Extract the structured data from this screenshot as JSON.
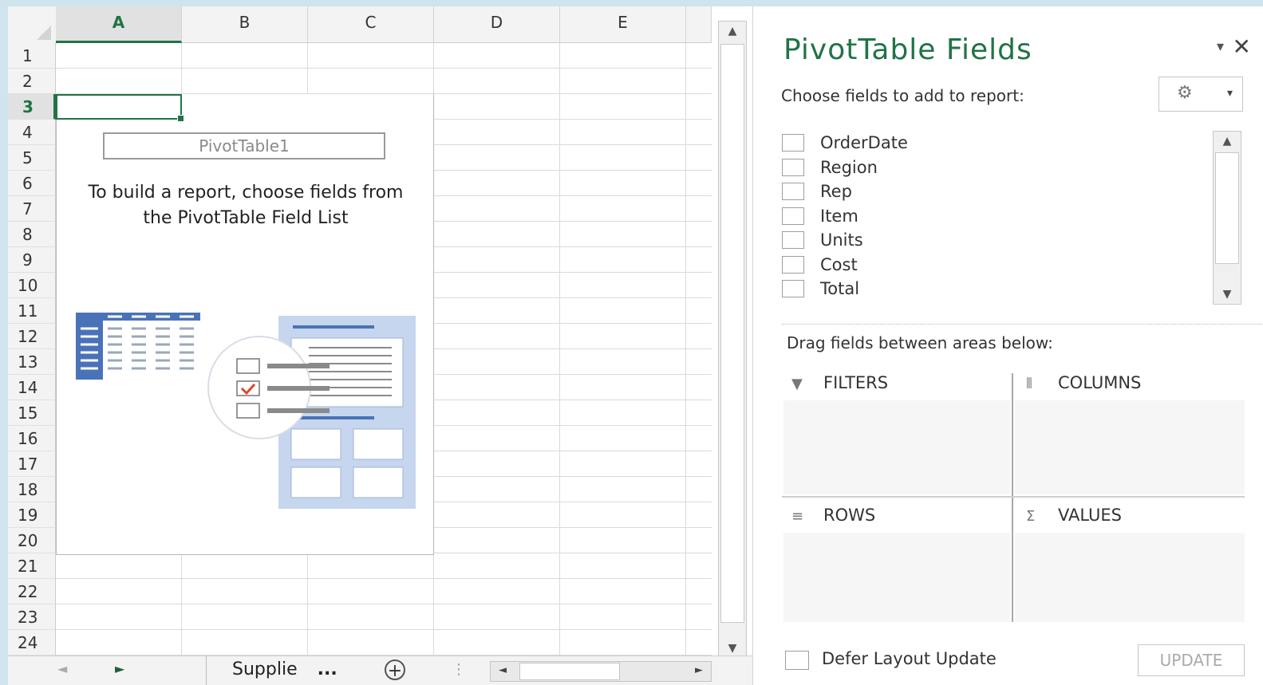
{
  "sheet": {
    "columns": [
      "A",
      "B",
      "C",
      "D",
      "E"
    ],
    "rows": [
      "1",
      "2",
      "3",
      "4",
      "5",
      "6",
      "7",
      "8",
      "9",
      "10",
      "11",
      "12",
      "13",
      "14",
      "15",
      "16",
      "17",
      "18",
      "19",
      "20",
      "21",
      "22",
      "23",
      "24"
    ],
    "selected_column": "A",
    "selected_row": "3",
    "pivot_placeholder": {
      "name": "PivotTable1",
      "instructions": "To build a report, choose fields from the PivotTable Field List"
    },
    "tabs": {
      "sheet_name": "Supplie",
      "ellipsis": "...",
      "add": "+",
      "prev": "◄",
      "next": "►"
    }
  },
  "pane": {
    "title": "PivotTable Fields",
    "dropdown": "▾",
    "close": "✕",
    "choose_label": "Choose fields to add to report:",
    "tools_icon": "⚙",
    "tools_caret": "▾",
    "fields": [
      "OrderDate",
      "Region",
      "Rep",
      "Item",
      "Units",
      "Cost",
      "Total"
    ],
    "drag_label": "Drag fields between areas below:",
    "areas": {
      "filters": "FILTERS",
      "columns": "COLUMNS",
      "rows": "ROWS",
      "values": "VALUES"
    },
    "defer_label": "Defer Layout Update",
    "update_label": "UPDATE"
  },
  "colors": {
    "accent": "#217346"
  }
}
